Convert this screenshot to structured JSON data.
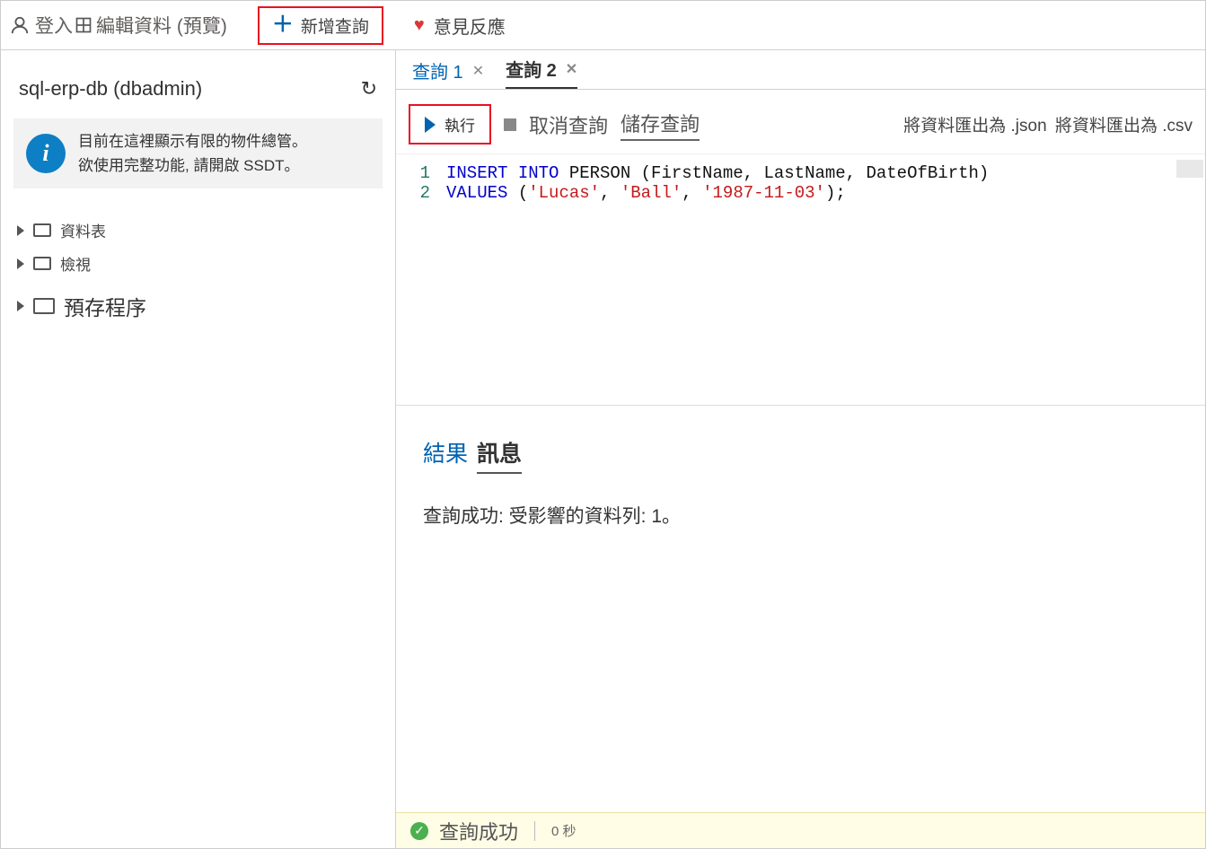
{
  "topbar": {
    "login": "登入",
    "edit_preview": "編輯資料 (預覽)",
    "new_query": "新增查詢",
    "feedback": "意見反應"
  },
  "sidebar": {
    "db_title": "sql-erp-db (dbadmin)",
    "info_line1": "目前在這裡顯示有限的物件總管。",
    "info_line2": "欲使用完整功能, 請開啟 SSDT。",
    "tree": {
      "tables": "資料表",
      "views": "檢視",
      "sprocs": "預存程序"
    }
  },
  "tabs": {
    "tab1": "查詢 1",
    "tab2": "查詢 2"
  },
  "toolbar": {
    "run": "執行",
    "cancel": "取消查詢",
    "save": "儲存查詢",
    "export_json": "將資料匯出為 .json",
    "export_csv": "將資料匯出為 .csv"
  },
  "editor": {
    "lines": [
      {
        "n": "1",
        "kw1": "INSERT INTO",
        "rest": " PERSON (FirstName, LastName, DateOfBirth)"
      },
      {
        "n": "2",
        "kw1": "VALUES",
        "paren_open": " (",
        "s1": "'Lucas'",
        "c1": ", ",
        "s2": "'Ball'",
        "c2": ", ",
        "s3": "'1987-11-03'",
        "paren_close": ");"
      }
    ]
  },
  "results": {
    "tab_results": "結果",
    "tab_messages": "訊息",
    "message": "查詢成功: 受影響的資料列: 1。"
  },
  "status": {
    "success": "查詢成功",
    "duration": "0 秒"
  }
}
